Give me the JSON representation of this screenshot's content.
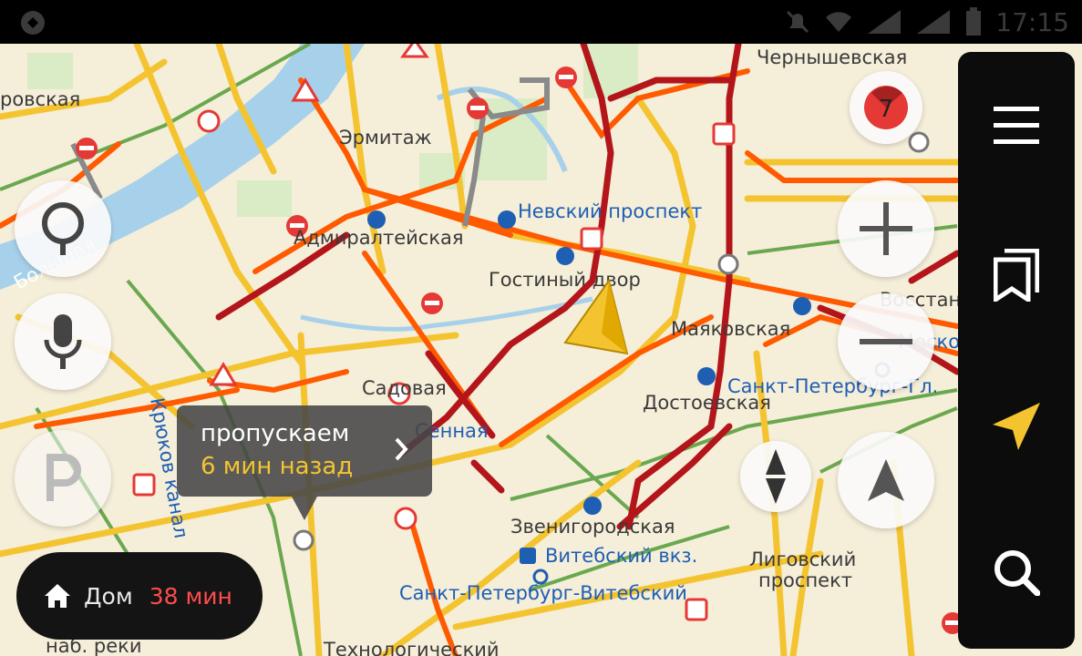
{
  "status_bar": {
    "time": "17:15"
  },
  "map": {
    "labels": [
      {
        "key": "l1",
        "text": "ровская"
      },
      {
        "key": "l2",
        "text": "Эрмитаж"
      },
      {
        "key": "l3",
        "text": "Невский проспект"
      },
      {
        "key": "l4",
        "text": "Адмиралтейская"
      },
      {
        "key": "l5",
        "text": "Гостиный двор"
      },
      {
        "key": "l6",
        "text": "Маяковская"
      },
      {
        "key": "l7",
        "text": "Сенная"
      },
      {
        "key": "l8",
        "text": "Садовая"
      },
      {
        "key": "l9",
        "text": "Достоевская"
      },
      {
        "key": "l10",
        "text": "Санкт-Петербург-Гл."
      },
      {
        "key": "l11",
        "text": "Звенигородская"
      },
      {
        "key": "l12",
        "text": "Витебский вкз."
      },
      {
        "key": "l13",
        "text": "Лиговский"
      },
      {
        "key": "l14",
        "text": "проспект"
      },
      {
        "key": "l15",
        "text": "Санкт-Петербург-Витебский"
      },
      {
        "key": "l16",
        "text": "Технологический"
      },
      {
        "key": "l17",
        "text": "наб. реки"
      },
      {
        "key": "l18",
        "text": "Чернышевская"
      },
      {
        "key": "l19",
        "text": "Большая"
      },
      {
        "key": "l20",
        "text": "Крюков канал"
      },
      {
        "key": "l21",
        "text": "Восстания"
      },
      {
        "key": "l22",
        "text": "Москов"
      }
    ]
  },
  "traffic_score": "7",
  "notice": {
    "line1": "пропускаем",
    "line2": "6 мин назад"
  },
  "home": {
    "label": "Дом",
    "time": "38 мин"
  },
  "colors": {
    "jam": "#c0151a",
    "slow": "#ff4b00",
    "free": "#f4c430",
    "accent": "#f4c430"
  }
}
